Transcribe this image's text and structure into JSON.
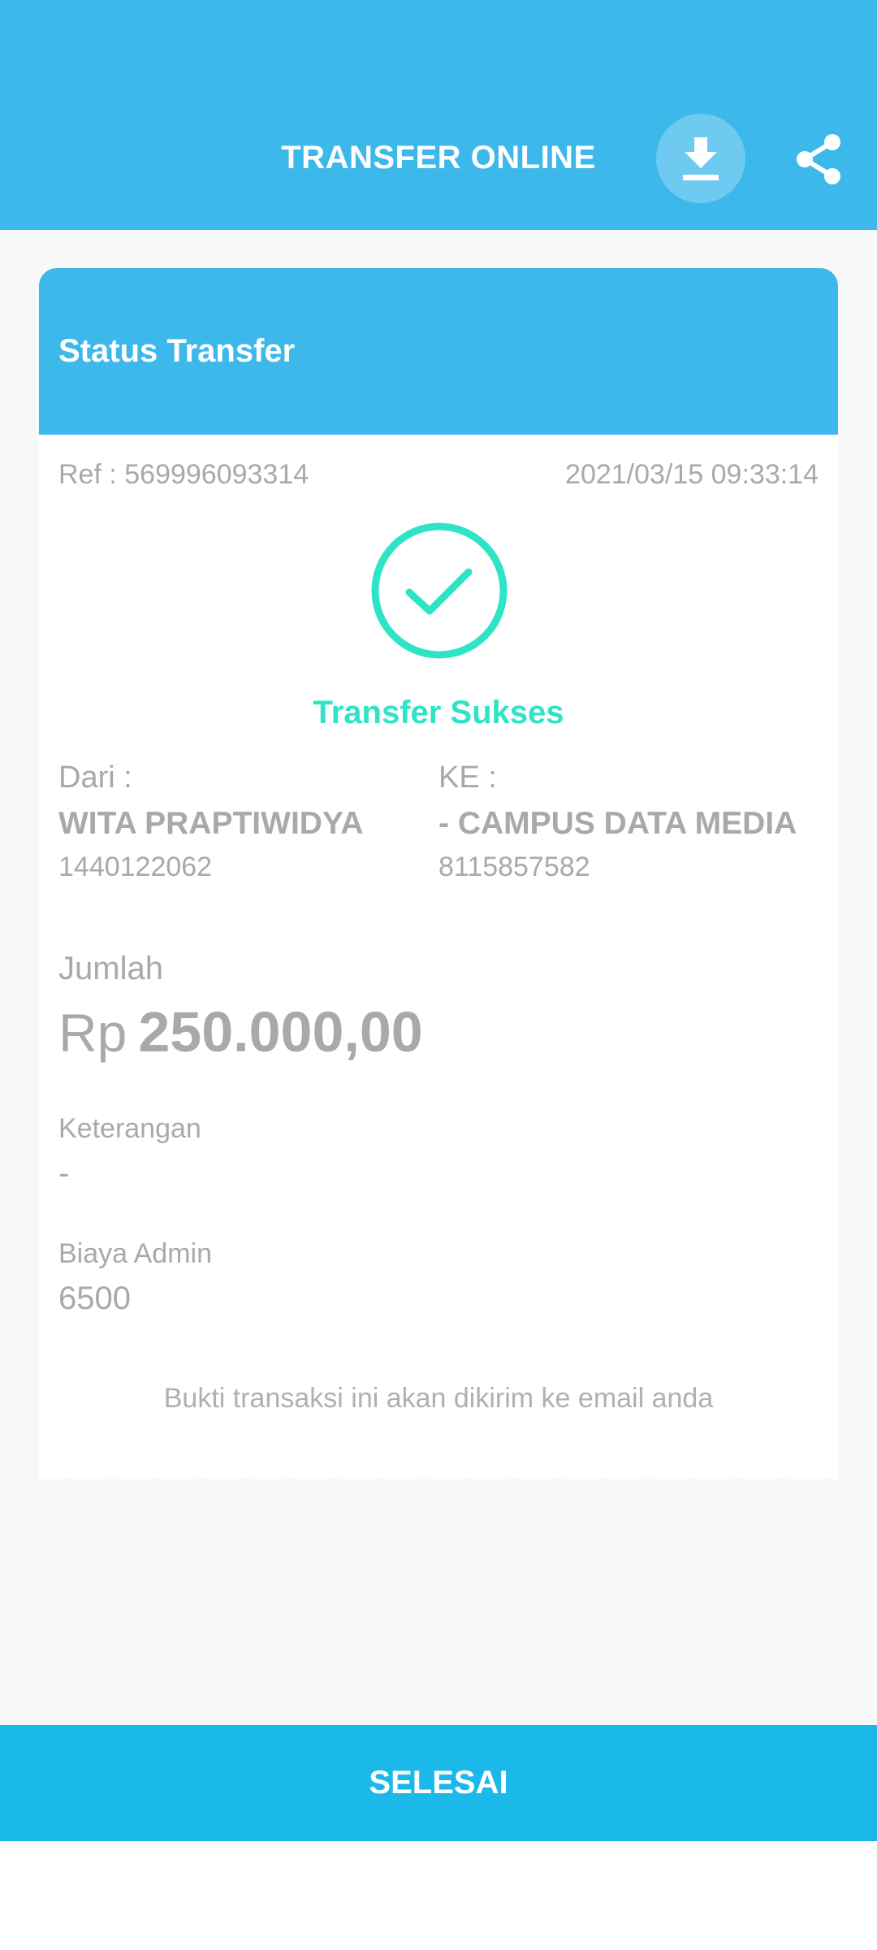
{
  "header": {
    "title": "TRANSFER ONLINE",
    "download_icon": "download-icon",
    "share_icon": "share-icon",
    "color": "#3db8ea"
  },
  "card": {
    "title": "Status Transfer",
    "ref": "Ref : 569996093314",
    "datetime": "2021/03/15 09:33:14",
    "status_icon": "check-circle-icon",
    "status_text": "Transfer Sukses",
    "status_color": "#2fe3c6",
    "from": {
      "label": "Dari :",
      "name": "WITA PRAPTIWIDYA",
      "account": "1440122062"
    },
    "to": {
      "label": "KE :",
      "name": "- CAMPUS DATA MEDIA",
      "account": "8115857582"
    },
    "amount": {
      "label": "Jumlah",
      "currency": "Rp",
      "value": "250.000,00"
    },
    "description": {
      "label": "Keterangan",
      "value": "-"
    },
    "admin_fee": {
      "label": "Biaya Admin",
      "value": "6500"
    },
    "footer_note": "Bukti transaksi ini akan dikirim ke email anda"
  },
  "done_button": {
    "label": "SELESAI"
  }
}
